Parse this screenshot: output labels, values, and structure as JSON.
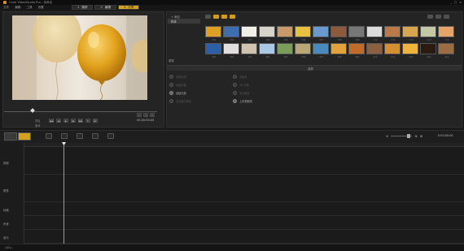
{
  "window": {
    "title": "Corel VideoStudio Pro - 未命名",
    "controls": [
      "_",
      "□",
      "×"
    ]
  },
  "menu": [
    "文件",
    "编辑",
    "工具",
    "设置"
  ],
  "steps": [
    {
      "num": "1",
      "label": "捕获"
    },
    {
      "num": "2",
      "label": "编辑"
    },
    {
      "num": "3",
      "label": "分享"
    }
  ],
  "player": {
    "mode_labels": [
      "项目",
      "素材"
    ],
    "timecode": "00:00:00:00",
    "transport": [
      "◀◀",
      "◀|",
      "▶",
      "|▶",
      "▶▶",
      "↻",
      "🔊"
    ]
  },
  "library": {
    "nav": [
      {
        "label": "+ 添加",
        "selected": false
      },
      {
        "label": "样本",
        "selected": true
      }
    ],
    "browse_label": "浏览",
    "options_label": "选项",
    "options": [
      {
        "label": "视频剪辑",
        "enabled": false
      },
      {
        "label": "多相机",
        "enabled": false
      },
      {
        "label": "创建字幕",
        "enabled": false
      },
      {
        "label": "3D 字幕",
        "enabled": false
      },
      {
        "label": "创建光盘",
        "enabled": true
      },
      {
        "label": "多点裁剪",
        "enabled": false
      },
      {
        "label": "自动音乐修剪",
        "enabled": false
      },
      {
        "label": "上传视频到",
        "enabled": true
      }
    ],
    "thumbs": [
      {
        "color": "#e0a028",
        "caption": "V01"
      },
      {
        "color": "#3d6fb0",
        "caption": "V02"
      },
      {
        "color": "#f0efe8",
        "caption": "V03"
      },
      {
        "color": "#d7d3c8",
        "caption": "V04"
      },
      {
        "color": "#c89a6a",
        "caption": "V05"
      },
      {
        "color": "#e8c040",
        "caption": "V06"
      },
      {
        "color": "#6a9acd",
        "caption": "V07"
      },
      {
        "color": "#8c5a3a",
        "caption": "V08"
      },
      {
        "color": "#777777",
        "caption": "V09"
      },
      {
        "color": "#dcdcdc",
        "caption": "V10"
      },
      {
        "color": "#b87a4a",
        "caption": "V11"
      },
      {
        "color": "#d8a64e",
        "caption": "V12"
      },
      {
        "color": "#c2c8a4",
        "caption": "V13"
      },
      {
        "color": "#e4a46a",
        "caption": "V14"
      },
      {
        "color": "#2d5ea8",
        "caption": "S01"
      },
      {
        "color": "#e2dede",
        "caption": "S02"
      },
      {
        "color": "#cfc3b0",
        "caption": "S03"
      },
      {
        "color": "#a8c8e4",
        "caption": "S04"
      },
      {
        "color": "#7a9e5a",
        "caption": "S05"
      },
      {
        "color": "#b8a878",
        "caption": "S06"
      },
      {
        "color": "#4a8aba",
        "caption": "S07"
      },
      {
        "color": "#e2a23c",
        "caption": "S08"
      },
      {
        "color": "#c26a2a",
        "caption": "S09"
      },
      {
        "color": "#8a6040",
        "caption": "S10"
      },
      {
        "color": "#d49030",
        "caption": "S11"
      },
      {
        "color": "#f0b43a",
        "caption": "S12"
      },
      {
        "color": "#2a1a10",
        "caption": "S13"
      },
      {
        "color": "#9c6c44",
        "caption": "S14"
      }
    ]
  },
  "timeline": {
    "time": "0:00:00:00",
    "tracks": [
      {
        "label": "视频"
      },
      {
        "label": "覆叠"
      },
      {
        "label": "标题"
      },
      {
        "label": "声音"
      },
      {
        "label": "音乐"
      }
    ]
  },
  "status": {
    "text": "100 ▸"
  },
  "colors": {
    "accent": "#d4a020",
    "panel": "#242424",
    "background": "#1a1a1a"
  }
}
